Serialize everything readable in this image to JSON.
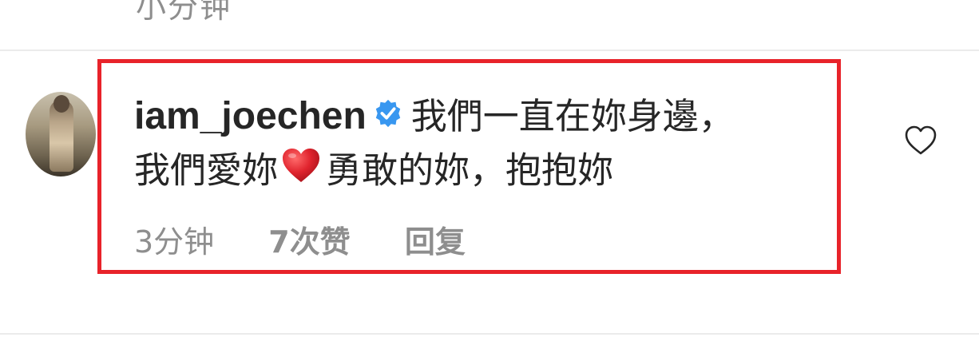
{
  "previous_comment": {
    "meta_fragment": "小分钟"
  },
  "comment": {
    "username": "iam_joechen",
    "verified": true,
    "text_line1": "我們一直在妳身邊，",
    "text_line2_before_emoji": "我們愛妳",
    "emoji": "heart-emoji",
    "text_line2_after_emoji": "勇敢的妳，抱抱妳",
    "time": "3分钟",
    "likes": "7次赞",
    "reply_label": "回复"
  },
  "colors": {
    "highlight_border": "#e8232a",
    "verified_badge": "#3897f0",
    "heart": "#e0242e",
    "meta_text": "#8e8e8e"
  }
}
